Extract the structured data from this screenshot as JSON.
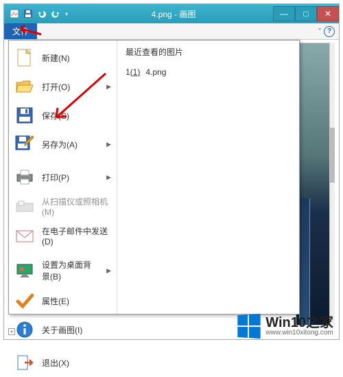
{
  "window": {
    "title": "4.png - 画图",
    "min": "—",
    "max": "□",
    "close": "✕"
  },
  "ribbon": {
    "file_tab": "文件",
    "help_caret": "ˇ"
  },
  "menu": {
    "new": "新建(N)",
    "open": "打开(O)",
    "save": "保存(S)",
    "saveas": "另存为(A)",
    "print": "打印(P)",
    "scanner": "从扫描仪或照相机(M)",
    "email": "在电子邮件中发送(D)",
    "wallpaper": "设置为桌面背景(B)",
    "properties": "属性(E)",
    "about": "关于画图(I)",
    "exit": "退出(X)"
  },
  "recent": {
    "heading": "最近查看的图片",
    "items": [
      {
        "key": "1",
        "accel": "(1)",
        "name": "4.png"
      }
    ]
  },
  "watermark": {
    "main": "Win10之家",
    "sub": "www.win10xitong.com"
  }
}
